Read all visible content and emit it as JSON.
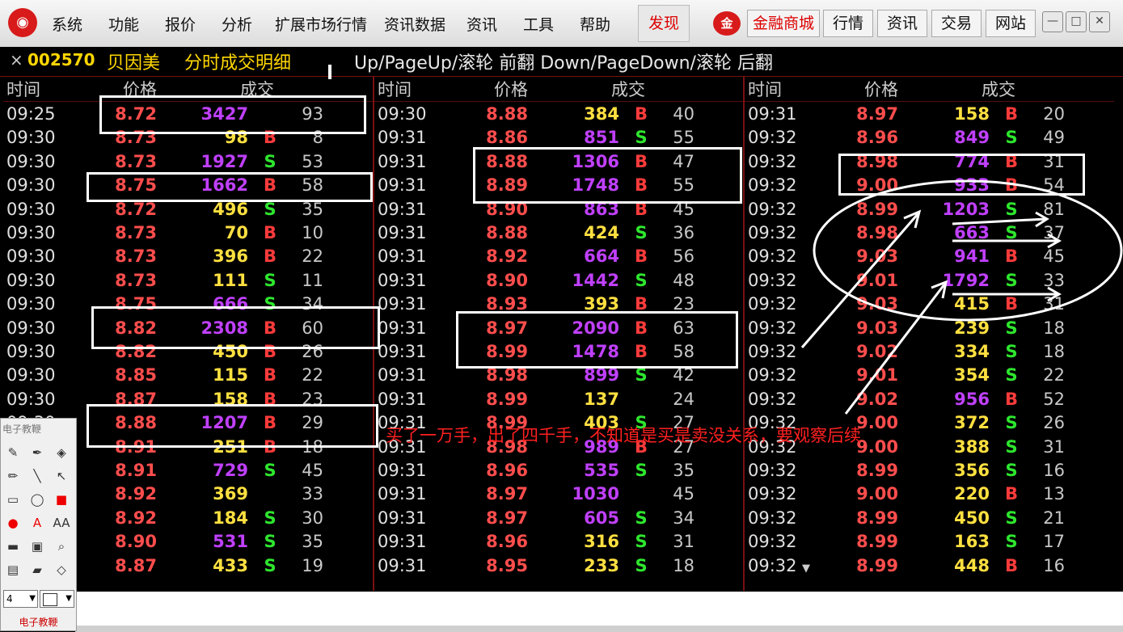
{
  "menubar": {
    "items": [
      "系统",
      "功能",
      "报价",
      "分析",
      "扩展市场行情",
      "资讯数据",
      "资讯",
      "工具",
      "帮助"
    ],
    "discover": "发现",
    "brand": "金融商城",
    "buttons": [
      "行情",
      "资讯",
      "交易",
      "网站"
    ],
    "win": [
      "—",
      "□",
      "✕"
    ]
  },
  "title": {
    "close": "×",
    "code": "002570",
    "name": "贝因美",
    "page": "分时成交明细",
    "hint": "Up/PageUp/滚轮 前翻 Down/PageDown/滚轮 后翻"
  },
  "headers": {
    "time": "时间",
    "price": "价格",
    "volume": "成交"
  },
  "colors": {
    "buy": "#ff3b3b",
    "sell": "#2ee62e",
    "price": "#ff4d4d",
    "vol_big": "#c040ff",
    "vol_small": "#ffe040"
  },
  "panels": [
    [
      {
        "t": "09:25",
        "p": "8.72",
        "v": "3427",
        "c": "m",
        "s": "",
        "n": "93"
      },
      {
        "t": "09:30",
        "p": "8.73",
        "v": "98",
        "c": "y",
        "s": "B",
        "n": "8"
      },
      {
        "t": "09:30",
        "p": "8.73",
        "v": "1927",
        "c": "m",
        "s": "S",
        "n": "53"
      },
      {
        "t": "09:30",
        "p": "8.75",
        "v": "1662",
        "c": "m",
        "s": "B",
        "n": "58"
      },
      {
        "t": "09:30",
        "p": "8.72",
        "v": "496",
        "c": "y",
        "s": "S",
        "n": "35"
      },
      {
        "t": "09:30",
        "p": "8.73",
        "v": "70",
        "c": "y",
        "s": "B",
        "n": "10"
      },
      {
        "t": "09:30",
        "p": "8.73",
        "v": "396",
        "c": "y",
        "s": "B",
        "n": "22"
      },
      {
        "t": "09:30",
        "p": "8.73",
        "v": "111",
        "c": "y",
        "s": "S",
        "n": "11"
      },
      {
        "t": "09:30",
        "p": "8.75",
        "v": "666",
        "c": "m",
        "s": "S",
        "n": "34"
      },
      {
        "t": "09:30",
        "p": "8.82",
        "v": "2308",
        "c": "m",
        "s": "B",
        "n": "60"
      },
      {
        "t": "09:30",
        "p": "8.82",
        "v": "450",
        "c": "y",
        "s": "B",
        "n": "26"
      },
      {
        "t": "09:30",
        "p": "8.85",
        "v": "115",
        "c": "y",
        "s": "B",
        "n": "22"
      },
      {
        "t": "09:30",
        "p": "8.87",
        "v": "158",
        "c": "y",
        "s": "B",
        "n": "23"
      },
      {
        "t": "09:30",
        "p": "8.88",
        "v": "1207",
        "c": "m",
        "s": "B",
        "n": "29"
      },
      {
        "t": "09:30",
        "p": "8.91",
        "v": "251",
        "c": "y",
        "s": "B",
        "n": "18"
      },
      {
        "t": "09:30",
        "p": "8.91",
        "v": "729",
        "c": "m",
        "s": "S",
        "n": "45"
      },
      {
        "t": "09:30",
        "p": "8.92",
        "v": "369",
        "c": "y",
        "s": "",
        "n": "33"
      },
      {
        "t": "09:30",
        "p": "8.92",
        "v": "184",
        "c": "y",
        "s": "S",
        "n": "30"
      },
      {
        "t": "09:30",
        "p": "8.90",
        "v": "531",
        "c": "m",
        "s": "S",
        "n": "35"
      },
      {
        "t": "09:30",
        "p": "8.87",
        "v": "433",
        "c": "y",
        "s": "S",
        "n": "19"
      }
    ],
    [
      {
        "t": "09:30",
        "p": "8.88",
        "v": "384",
        "c": "y",
        "s": "B",
        "n": "40"
      },
      {
        "t": "09:31",
        "p": "8.86",
        "v": "851",
        "c": "m",
        "s": "S",
        "n": "55"
      },
      {
        "t": "09:31",
        "p": "8.88",
        "v": "1306",
        "c": "m",
        "s": "B",
        "n": "47"
      },
      {
        "t": "09:31",
        "p": "8.89",
        "v": "1748",
        "c": "m",
        "s": "B",
        "n": "55"
      },
      {
        "t": "09:31",
        "p": "8.90",
        "v": "863",
        "c": "m",
        "s": "B",
        "n": "45"
      },
      {
        "t": "09:31",
        "p": "8.88",
        "v": "424",
        "c": "y",
        "s": "S",
        "n": "36"
      },
      {
        "t": "09:31",
        "p": "8.92",
        "v": "664",
        "c": "m",
        "s": "B",
        "n": "56"
      },
      {
        "t": "09:31",
        "p": "8.90",
        "v": "1442",
        "c": "m",
        "s": "S",
        "n": "48"
      },
      {
        "t": "09:31",
        "p": "8.93",
        "v": "393",
        "c": "y",
        "s": "B",
        "n": "23"
      },
      {
        "t": "09:31",
        "p": "8.97",
        "v": "2090",
        "c": "m",
        "s": "B",
        "n": "63"
      },
      {
        "t": "09:31",
        "p": "8.99",
        "v": "1478",
        "c": "m",
        "s": "B",
        "n": "58"
      },
      {
        "t": "09:31",
        "p": "8.98",
        "v": "899",
        "c": "m",
        "s": "S",
        "n": "42"
      },
      {
        "t": "09:31",
        "p": "8.99",
        "v": "137",
        "c": "y",
        "s": "",
        "n": "24"
      },
      {
        "t": "09:31",
        "p": "8.99",
        "v": "403",
        "c": "y",
        "s": "S",
        "n": "27"
      },
      {
        "t": "09:31",
        "p": "8.98",
        "v": "989",
        "c": "m",
        "s": "B",
        "n": "27"
      },
      {
        "t": "09:31",
        "p": "8.96",
        "v": "535",
        "c": "m",
        "s": "S",
        "n": "35"
      },
      {
        "t": "09:31",
        "p": "8.97",
        "v": "1030",
        "c": "m",
        "s": "",
        "n": "45"
      },
      {
        "t": "09:31",
        "p": "8.97",
        "v": "605",
        "c": "m",
        "s": "S",
        "n": "34"
      },
      {
        "t": "09:31",
        "p": "8.96",
        "v": "316",
        "c": "y",
        "s": "S",
        "n": "31"
      },
      {
        "t": "09:31",
        "p": "8.95",
        "v": "233",
        "c": "y",
        "s": "S",
        "n": "18"
      }
    ],
    [
      {
        "t": "09:31",
        "p": "8.97",
        "v": "158",
        "c": "y",
        "s": "B",
        "n": "20"
      },
      {
        "t": "09:32",
        "p": "8.96",
        "v": "849",
        "c": "m",
        "s": "S",
        "n": "49"
      },
      {
        "t": "09:32",
        "p": "8.98",
        "v": "774",
        "c": "m",
        "s": "B",
        "n": "31"
      },
      {
        "t": "09:32",
        "p": "9.00",
        "v": "933",
        "c": "m",
        "s": "B",
        "n": "54"
      },
      {
        "t": "09:32",
        "p": "8.99",
        "v": "1203",
        "c": "m",
        "s": "S",
        "n": "81"
      },
      {
        "t": "09:32",
        "p": "8.98",
        "v": "663",
        "c": "m",
        "s": "S",
        "n": "37"
      },
      {
        "t": "09:32",
        "p": "9.03",
        "v": "941",
        "c": "m",
        "s": "B",
        "n": "45"
      },
      {
        "t": "09:32",
        "p": "9.01",
        "v": "1792",
        "c": "m",
        "s": "S",
        "n": "33"
      },
      {
        "t": "09:32",
        "p": "9.03",
        "v": "415",
        "c": "y",
        "s": "B",
        "n": "31"
      },
      {
        "t": "09:32",
        "p": "9.03",
        "v": "239",
        "c": "y",
        "s": "S",
        "n": "18"
      },
      {
        "t": "09:32",
        "p": "9.02",
        "v": "334",
        "c": "y",
        "s": "S",
        "n": "18"
      },
      {
        "t": "09:32",
        "p": "9.01",
        "v": "354",
        "c": "y",
        "s": "S",
        "n": "22"
      },
      {
        "t": "09:32",
        "p": "9.02",
        "v": "956",
        "c": "m",
        "s": "B",
        "n": "52"
      },
      {
        "t": "09:32",
        "p": "9.00",
        "v": "372",
        "c": "y",
        "s": "S",
        "n": "26"
      },
      {
        "t": "09:32",
        "p": "9.00",
        "v": "388",
        "c": "y",
        "s": "S",
        "n": "31"
      },
      {
        "t": "09:32",
        "p": "8.99",
        "v": "356",
        "c": "y",
        "s": "S",
        "n": "16"
      },
      {
        "t": "09:32",
        "p": "9.00",
        "v": "220",
        "c": "y",
        "s": "B",
        "n": "13"
      },
      {
        "t": "09:32",
        "p": "8.99",
        "v": "450",
        "c": "y",
        "s": "S",
        "n": "21"
      },
      {
        "t": "09:32",
        "p": "8.99",
        "v": "163",
        "c": "y",
        "s": "S",
        "n": "17"
      },
      {
        "t": "09:32",
        "p": "8.99",
        "v": "448",
        "c": "y",
        "s": "B",
        "n": "16"
      }
    ]
  ],
  "annotation": "买了一万手，出了四千手，不知道是买是卖没关系，要观察后续",
  "tools": {
    "title": "电子教鞭",
    "footer": "电子教鞭",
    "size": "4",
    "icons": [
      "eraser-icon",
      "pen-icon",
      "fill-icon",
      "pencil-icon",
      "line-icon",
      "arrow-icon",
      "rect-icon",
      "ellipse-icon",
      "filled-rect-icon",
      "filled-ellipse-icon",
      "text-icon",
      "font-size-icon",
      "color-bar-icon",
      "screenshot-icon",
      "zoom-icon",
      "save-icon",
      "open-icon",
      "clear-icon"
    ],
    "glyphs": [
      "✎",
      "✒",
      "◈",
      "✏",
      "╲",
      "↖",
      "▭",
      "◯",
      "■",
      "●",
      "A",
      "AA",
      "▬",
      "▣",
      "⌕",
      "▤",
      "▰",
      "◇"
    ]
  }
}
